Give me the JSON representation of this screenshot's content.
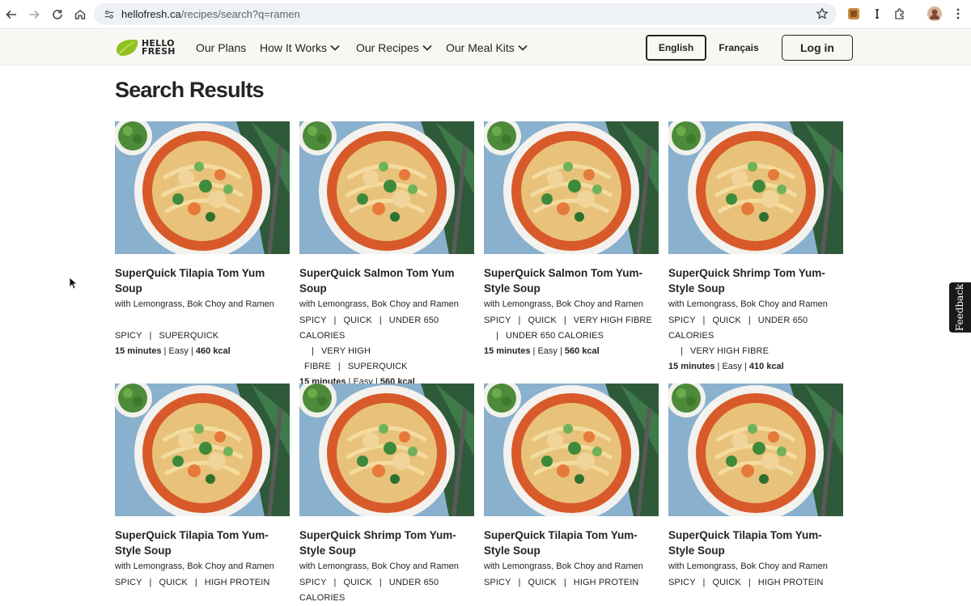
{
  "browser": {
    "url_host": "hellofresh.ca",
    "url_path": "/recipes/search?q=ramen"
  },
  "header": {
    "logo_line1": "HELLO",
    "logo_line2": "FRESH",
    "nav": [
      "Our Plans",
      "How It Works",
      "Our Recipes",
      "Our Meal Kits"
    ],
    "lang_en": "English",
    "lang_fr": "Français",
    "login": "Log in"
  },
  "page_title": "Search Results",
  "feedback": "Feedback",
  "colors": {
    "brand_green": "#91c11e",
    "text": "#242424",
    "header_bg": "#f8f7f4"
  },
  "cards": [
    {
      "title": "SuperQuick Tilapia Tom Yum Soup",
      "subtitle": "with Lemongrass, Bok Choy and Ramen",
      "tags_l1": [
        "SPICY",
        "SUPERQUICK"
      ],
      "tags_l2": [],
      "time": "15 minutes",
      "difficulty": "Easy",
      "kcal": "460 kcal"
    },
    {
      "title": "SuperQuick Salmon Tom Yum Soup",
      "subtitle": "with Lemongrass, Bok Choy and Ramen",
      "tags_l1": [
        "SPICY",
        "QUICK",
        "UNDER 650 CALORIES"
      ],
      "tags_l2": [
        "VERY HIGH FIBRE",
        "SUPERQUICK"
      ],
      "time": "15 minutes",
      "difficulty": "Easy",
      "kcal": "560 kcal"
    },
    {
      "title": "SuperQuick Salmon Tom Yum-Style Soup",
      "subtitle": "with Lemongrass, Bok Choy and Ramen",
      "tags_l1": [
        "SPICY",
        "QUICK",
        "VERY HIGH FIBRE"
      ],
      "tags_l2": [
        "UNDER 650 CALORIES"
      ],
      "time": "15 minutes",
      "difficulty": "Easy",
      "kcal": "560 kcal"
    },
    {
      "title": "SuperQuick Shrimp Tom Yum-Style Soup",
      "subtitle": "with Lemongrass, Bok Choy and Ramen",
      "tags_l1": [
        "SPICY",
        "QUICK",
        "UNDER 650 CALORIES"
      ],
      "tags_l2": [
        "VERY HIGH FIBRE"
      ],
      "time": "15 minutes",
      "difficulty": "Easy",
      "kcal": "410 kcal"
    },
    {
      "title": "SuperQuick Tilapia Tom Yum-Style Soup",
      "subtitle": "with Lemongrass, Bok Choy and Ramen",
      "tags_l1": [
        "SPICY",
        "QUICK",
        "HIGH PROTEIN"
      ],
      "tags_l2": [],
      "time": "",
      "difficulty": "",
      "kcal": ""
    },
    {
      "title": "SuperQuick Shrimp Tom Yum-Style Soup",
      "subtitle": "with Lemongrass, Bok Choy and Ramen",
      "tags_l1": [
        "SPICY",
        "QUICK",
        "UNDER 650 CALORIES"
      ],
      "tags_l2": [],
      "time": "",
      "difficulty": "",
      "kcal": ""
    },
    {
      "title": "SuperQuick Tilapia Tom Yum-Style Soup",
      "subtitle": "with Lemongrass, Bok Choy and Ramen",
      "tags_l1": [
        "SPICY",
        "QUICK",
        "HIGH PROTEIN"
      ],
      "tags_l2": [],
      "time": "",
      "difficulty": "",
      "kcal": ""
    },
    {
      "title": "SuperQuick Tilapia Tom Yum-Style Soup",
      "subtitle": "with Lemongrass, Bok Choy and Ramen",
      "tags_l1": [
        "SPICY",
        "QUICK",
        "HIGH PROTEIN"
      ],
      "tags_l2": [],
      "time": "",
      "difficulty": "",
      "kcal": ""
    }
  ]
}
